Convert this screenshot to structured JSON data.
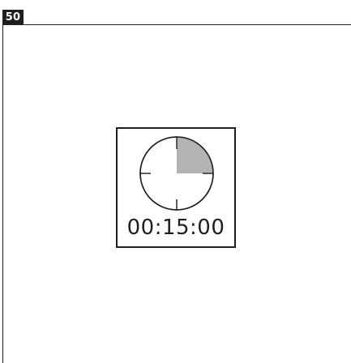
{
  "page": {
    "number": "50"
  },
  "timer": {
    "readout": "00:15:00",
    "elapsed_fraction": 0.25,
    "icon": "clock-icon",
    "colors": {
      "ink": "#1f1f1f",
      "elapsed_fill": "#b3b3b3",
      "face": "#ffffff"
    }
  }
}
